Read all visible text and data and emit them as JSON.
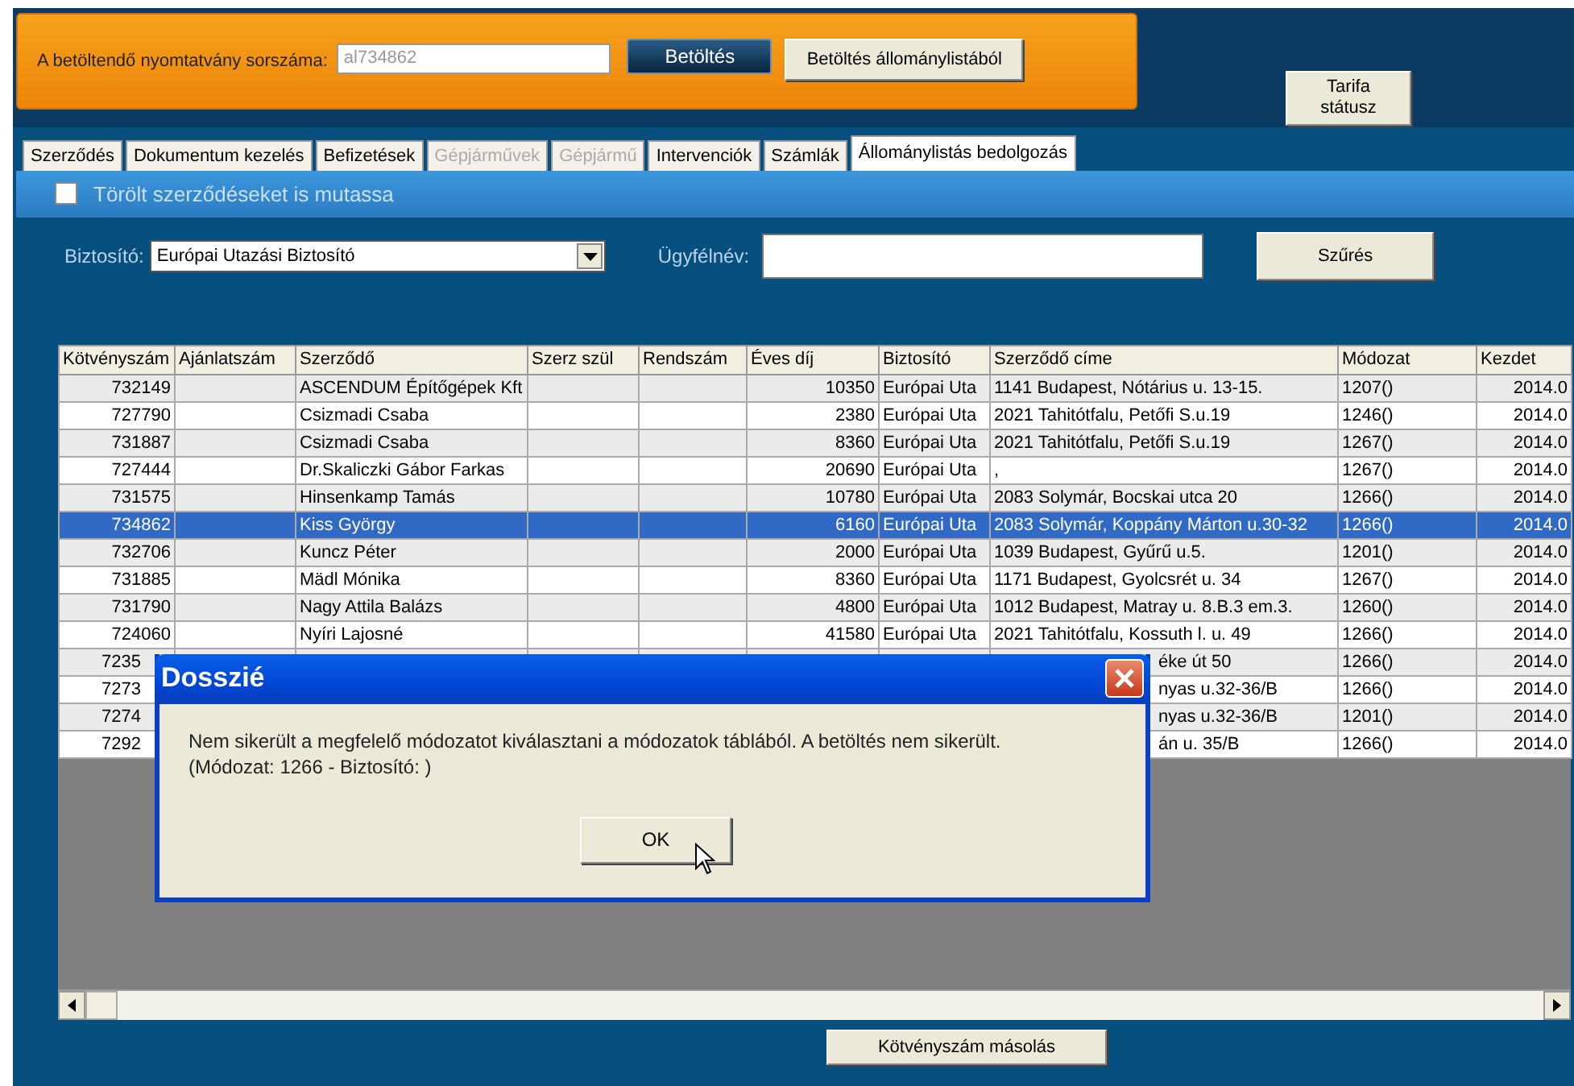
{
  "load_bar": {
    "label": "A betöltendő nyomtatvány sorszáma:",
    "value": "al734862",
    "load_button": "Betöltés",
    "load_from_list_button": "Betöltés állománylistából"
  },
  "tariff_button": "Tarifa státusz",
  "tabs": [
    {
      "label": "Szerződés",
      "selected": false,
      "disabled": false
    },
    {
      "label": "Dokumentum kezelés",
      "selected": false,
      "disabled": false
    },
    {
      "label": "Befizetések",
      "selected": false,
      "disabled": false
    },
    {
      "label": "Gépjárművek",
      "selected": false,
      "disabled": true
    },
    {
      "label": "Gépjármű",
      "selected": false,
      "disabled": true
    },
    {
      "label": "Intervenciók",
      "selected": false,
      "disabled": false
    },
    {
      "label": "Számlák",
      "selected": false,
      "disabled": false
    },
    {
      "label": "Állománylistás bedolgozás",
      "selected": true,
      "disabled": false
    }
  ],
  "show_deleted": {
    "label": "Törölt szerződéseket is mutassa",
    "checked": false
  },
  "filter": {
    "insurer_label": "Biztosító:",
    "insurer_value": "Európai Utazási Biztosító",
    "client_label": "Ügyfélnév:",
    "filter_button": "Szűrés"
  },
  "table": {
    "columns": [
      "Kötvényszám",
      "Ajánlatszám",
      "Szerződő",
      "Szerz szül",
      "Rendszám",
      "Éves díj",
      "Biztosító",
      "Szerződő címe",
      "Módozat",
      "Kezdet"
    ],
    "rows": [
      {
        "kind": "full",
        "selected": false,
        "policy_no": "732149",
        "holder": "ASCENDUM Építőgépek Kft",
        "annual_fee": "10350",
        "insurer": "Európai Uta",
        "address": "1141 Budapest, Nótárius u. 13-15.",
        "plan": "1207()",
        "start": "2014.0"
      },
      {
        "kind": "full",
        "selected": false,
        "policy_no": "727790",
        "holder": "Csizmadi Csaba",
        "annual_fee": "2380",
        "insurer": "Európai Uta",
        "address": "2021 Tahitótfalu, Petőfi S.u.19",
        "plan": "1246()",
        "start": "2014.0"
      },
      {
        "kind": "full",
        "selected": false,
        "policy_no": "731887",
        "holder": "Csizmadi Csaba",
        "annual_fee": "8360",
        "insurer": "Európai Uta",
        "address": "2021 Tahitótfalu, Petőfi S.u.19",
        "plan": "1267()",
        "start": "2014.0"
      },
      {
        "kind": "full",
        "selected": false,
        "policy_no": "727444",
        "holder": "Dr.Skaliczki Gábor Farkas",
        "annual_fee": "20690",
        "insurer": "Európai Uta",
        "address": ",",
        "plan": "1267()",
        "start": "2014.0"
      },
      {
        "kind": "full",
        "selected": false,
        "policy_no": "731575",
        "holder": "Hinsenkamp Tamás",
        "annual_fee": "10780",
        "insurer": "Európai Uta",
        "address": "2083 Solymár, Bocskai utca 20",
        "plan": "1266()",
        "start": "2014.0"
      },
      {
        "kind": "full",
        "selected": true,
        "policy_no": "734862",
        "holder": "Kiss György",
        "annual_fee": "6160",
        "insurer": "Európai Uta",
        "address": "2083 Solymár, Koppány Márton u.30-32",
        "plan": "1266()",
        "start": "2014.0"
      },
      {
        "kind": "full",
        "selected": false,
        "policy_no": "732706",
        "holder": "Kuncz Péter",
        "annual_fee": "2000",
        "insurer": "Európai Uta",
        "address": "1039 Budapest, Gyűrű u.5.",
        "plan": "1201()",
        "start": "2014.0"
      },
      {
        "kind": "full",
        "selected": false,
        "policy_no": "731885",
        "holder": "Mädl Mónika",
        "annual_fee": "8360",
        "insurer": "Európai Uta",
        "address": "1171 Budapest, Gyolcsrét u. 34",
        "plan": "1267()",
        "start": "2014.0"
      },
      {
        "kind": "full",
        "selected": false,
        "policy_no": "731790",
        "holder": "Nagy Attila Balázs",
        "annual_fee": "4800",
        "insurer": "Európai Uta",
        "address": "1012 Budapest, Matray u. 8.B.3 em.3.",
        "plan": "1260()",
        "start": "2014.0"
      },
      {
        "kind": "full",
        "selected": false,
        "policy_no": "724060",
        "holder": "Nyíri Lajosné",
        "annual_fee": "41580",
        "insurer": "Európai Uta",
        "address": "2021 Tahitótfalu, Kossuth l. u. 49",
        "plan": "1266()",
        "start": "2014.0"
      },
      {
        "kind": "covered",
        "selected": false,
        "policy_no": "7235",
        "address": "éke út 50",
        "plan": "1266()",
        "start": "2014.0"
      },
      {
        "kind": "covered",
        "selected": false,
        "policy_no": "7273",
        "address": "nyas u.32-36/B",
        "plan": "1266()",
        "start": "2014.0"
      },
      {
        "kind": "covered",
        "selected": false,
        "policy_no": "7274",
        "address": "nyas u.32-36/B",
        "plan": "1201()",
        "start": "2014.0"
      },
      {
        "kind": "covered",
        "selected": false,
        "policy_no": "7292",
        "address": "án u. 35/B",
        "plan": "1266()",
        "start": "2014.0"
      }
    ]
  },
  "dialog": {
    "title": "Dosszié",
    "message": "Nem sikerült a megfelelő módozatot kiválasztani a módozatok táblából. A betöltés nem sikerült.",
    "detail": "(Módozat: 1266 - Biztosító: )",
    "ok_button": "OK"
  },
  "copy_button": "Kötvényszám másolás"
}
